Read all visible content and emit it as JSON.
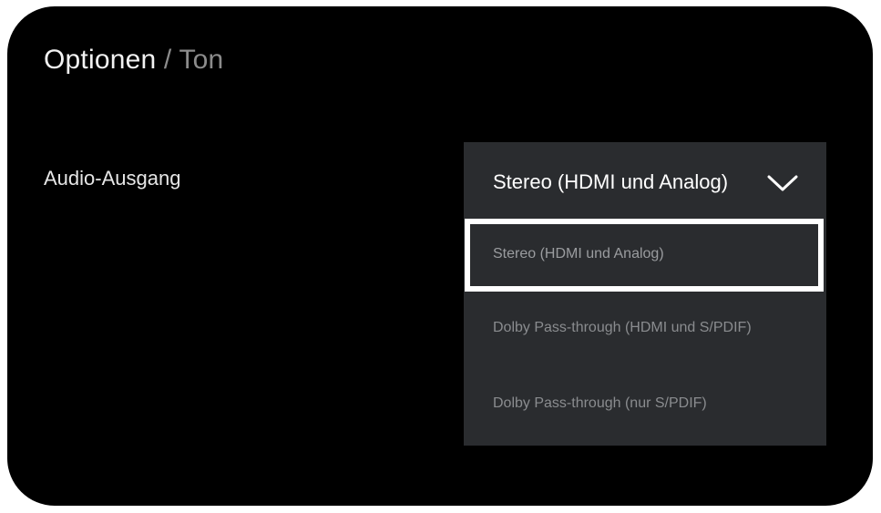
{
  "header": {
    "breadcrumb_current": "Optionen",
    "breadcrumb_separator": " / ",
    "breadcrumb_child": "Ton"
  },
  "setting": {
    "label": "Audio-Ausgang",
    "selected_value": "Stereo (HDMI und Analog)",
    "options": [
      {
        "label": "Stereo (HDMI und Analog)",
        "selected": true
      },
      {
        "label": "Dolby Pass-through (HDMI und S/PDIF)",
        "selected": false
      },
      {
        "label": "Dolby Pass-through (nur S/PDIF)",
        "selected": false
      }
    ]
  },
  "icons": {
    "dropdown_indicator": "chevron-down-icon"
  },
  "colors": {
    "background": "#000000",
    "dropdown_background": "#2a2c2f",
    "focus_border": "#ffffff",
    "primary_text": "#ffffff",
    "secondary_text": "#8c8c8c"
  }
}
